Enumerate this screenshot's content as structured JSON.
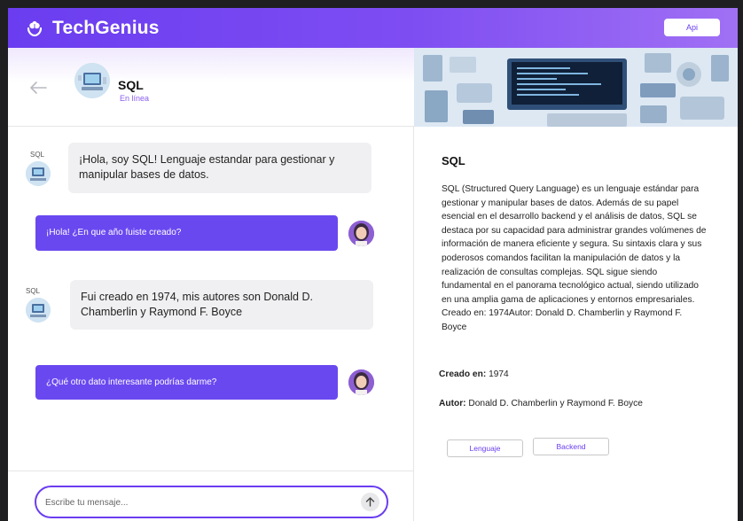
{
  "app": {
    "brand": "TechGenius",
    "api_label": "Api",
    "accent": "#6a3df0"
  },
  "chat": {
    "header": {
      "name": "SQL",
      "status": "En línea"
    },
    "messages": [
      {
        "role": "bot",
        "sender_label": "SQL",
        "text": "¡Hola, soy SQL! Lenguaje estandar para gestionar y manipular bases de datos."
      },
      {
        "role": "user",
        "text": "¡Hola! ¿En que año fuiste creado?"
      },
      {
        "role": "bot",
        "sender_label": "SQL",
        "text": "Fui creado en 1974, mis autores son Donald D. Chamberlin y Raymond F. Boyce"
      },
      {
        "role": "user",
        "text": "¿Qué otro dato interesante podrías darme?"
      }
    ],
    "composer": {
      "placeholder": "Escribe tu mensaje..."
    }
  },
  "details": {
    "title": "SQL",
    "description": "SQL (Structured Query Language) es un lenguaje estándar para gestionar y manipular bases de datos. Además de su papel esencial en el desarrollo backend y el análisis de datos, SQL se destaca por su capacidad para administrar grandes volúmenes de información de manera eficiente y segura. Su sintaxis clara y sus poderosos comandos facilitan la manipulación de datos y la realización de consultas complejas. SQL sigue siendo fundamental en el panorama tecnológico actual, siendo utilizado en una amplia gama de aplicaciones y entornos empresariales.",
    "summary_line": "Creado en: 1974Autor: Donald D. Chamberlin y Raymond F. Boyce",
    "created_label": "Creado en:",
    "created_value": "1974",
    "author_label": "Autor:",
    "author_value": "Donald D. Chamberlin y Raymond F. Boyce",
    "tags": [
      "Lenguaje",
      "Backend"
    ]
  }
}
